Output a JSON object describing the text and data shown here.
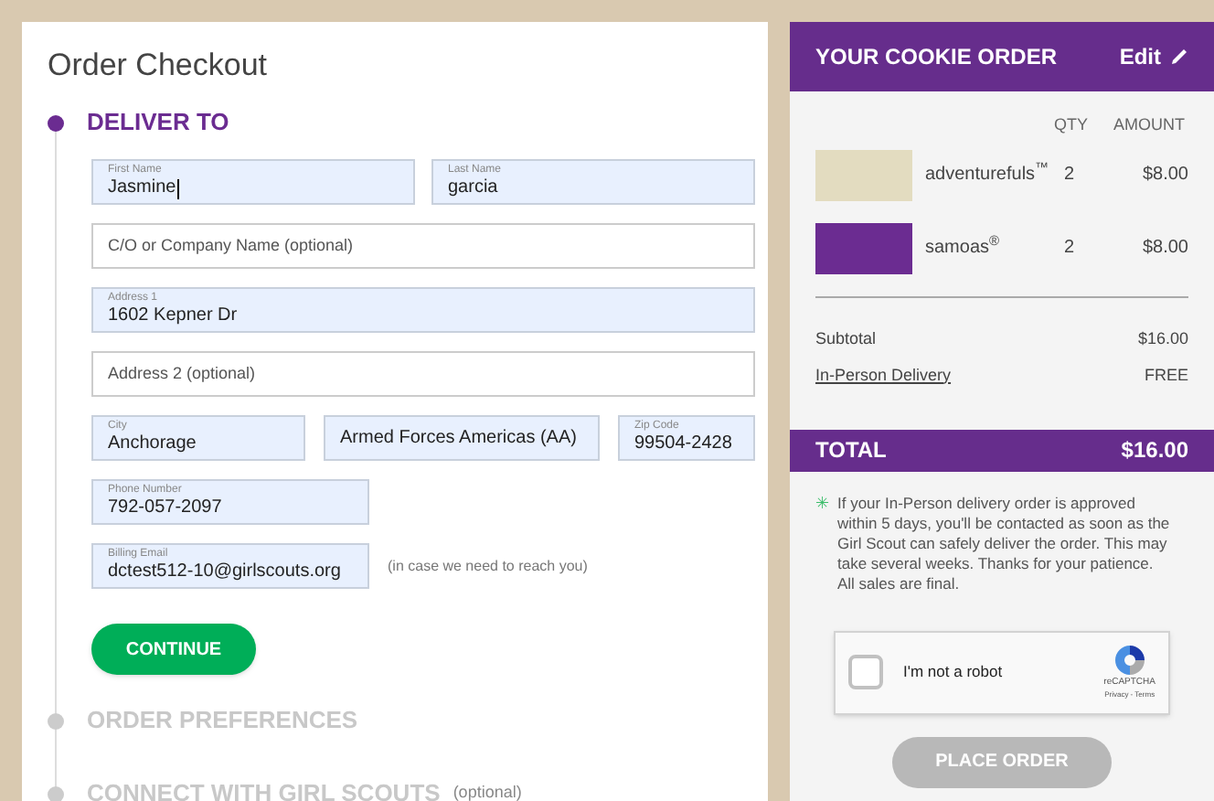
{
  "page_title": "Order Checkout",
  "steps": [
    {
      "label": "DELIVER TO",
      "selected": true
    },
    {
      "label": "ORDER PREFERENCES",
      "selected": false
    },
    {
      "label": "CONNECT WITH GIRL SCOUTS",
      "note": "(optional)",
      "selected": false
    }
  ],
  "form": {
    "rows": [
      [
        {
          "label": "First Name",
          "value": "Jasmine",
          "focused": true
        },
        {
          "label": "Last Name",
          "value": "garcia",
          "focused": false
        }
      ],
      [
        {
          "placeholder": "C/O or Company Name (optional)"
        }
      ],
      [
        {
          "label": "Address 1",
          "value": "1602 Kepner Dr",
          "focused": false
        }
      ],
      [
        {
          "placeholder": "Address 2 (optional)"
        }
      ],
      [
        {
          "label": "City",
          "value": "Anchorage",
          "focused": false
        },
        {
          "value": "Armed Forces Americas (AA)",
          "focused": false
        },
        {
          "label": "Zip Code",
          "value": "99504-2428",
          "focused": false
        }
      ],
      [
        {
          "label": "Phone Number",
          "value": "792-057-2097",
          "focused": false
        }
      ],
      [
        {
          "label": "Billing Email",
          "value": "dctest512-10@girlscouts.org",
          "focused": false,
          "hint": "(in case we need to reach you)"
        }
      ]
    ],
    "continue": "CONTINUE"
  },
  "order": {
    "title": "YOUR COOKIE ORDER",
    "edit": "Edit",
    "columns": [
      "QTY",
      "AMOUNT"
    ],
    "items": [
      {
        "name": "adventurefuls$^{™}$",
        "qty": "2",
        "amount": "$8.00",
        "color": "#e3dcc0"
      },
      {
        "name": "samoas$^{®}$",
        "qty": "2",
        "amount": "$8.00",
        "color": "#6b2c91"
      }
    ],
    "subtotal": {
      "label": "Subtotal",
      "value": "$16.00"
    },
    "delivery": {
      "label": "In-Person Delivery",
      "value": "FREE"
    },
    "total": {
      "label": "TOTAL",
      "value": "$16.00"
    },
    "notice_mark": "✳",
    "notice": "If your In-Person delivery order is approved within 5 days, you'll be contacted as soon as the Girl Scout can safely deliver the order. This may take several weeks. Thanks for your patience.",
    "notice_final": "All sales are final.",
    "captcha": {
      "label": "I'm not a robot",
      "checked": false,
      "brand": "reCAPTCHA",
      "links": "Privacy - Terms"
    },
    "place_order": {
      "label": "PLACE ORDER",
      "disabled": true
    }
  }
}
